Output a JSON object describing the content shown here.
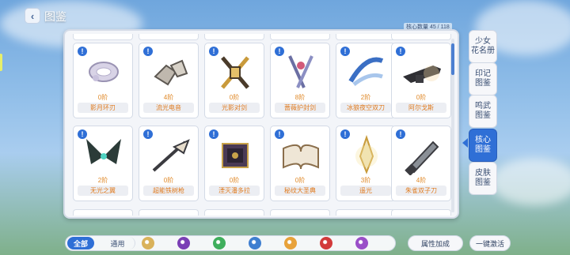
{
  "header": {
    "back_icon": "chevron-left-icon",
    "title": "图鉴",
    "count_label": "核心数量 45 / 118"
  },
  "cards": [
    {
      "tier": "0阶",
      "name": "影月环刃",
      "art": "silver-ring"
    },
    {
      "tier": "4阶",
      "name": "流光电音",
      "art": "stone-pieces"
    },
    {
      "tier": "0阶",
      "name": "光影对剑",
      "art": "crossed-blades"
    },
    {
      "tier": "8阶",
      "name": "蔷薇护封剑",
      "art": "rose-swords"
    },
    {
      "tier": "2阶",
      "name": "冰狼夜空双刀",
      "art": "ice-blades"
    },
    {
      "tier": "0阶",
      "name": "阿尔戈斯",
      "art": "rifle"
    },
    {
      "tier": "2阶",
      "name": "无光之翼",
      "art": "dark-wings"
    },
    {
      "tier": "0阶",
      "name": "超能铁树枪",
      "art": "lance"
    },
    {
      "tier": "0阶",
      "name": "湮灭潘多拉",
      "art": "pandora-box"
    },
    {
      "tier": "0阶",
      "name": "秘纹大圣典",
      "art": "open-book"
    },
    {
      "tier": "3阶",
      "name": "遥光",
      "art": "gold-blade"
    },
    {
      "tier": "4阶",
      "name": "朱雀双子刀",
      "art": "knife"
    }
  ],
  "side_tabs": [
    {
      "label": "少女\n花名册",
      "active": false
    },
    {
      "label": "印记\n图鉴",
      "active": false
    },
    {
      "label": "鸣武\n图鉴",
      "active": false
    },
    {
      "label": "核心\n图鉴",
      "active": true
    },
    {
      "label": "皮肤\n图鉴",
      "active": false
    }
  ],
  "filters": {
    "all": "全部",
    "general": "通用"
  },
  "filter_icons": [
    {
      "name": "element-light-icon",
      "color": "#d9b25a"
    },
    {
      "name": "element-dark-icon",
      "color": "#7a3fb5"
    },
    {
      "name": "element-wind-icon",
      "color": "#3fae5c"
    },
    {
      "name": "element-shield-icon",
      "color": "#3f7fd0"
    },
    {
      "name": "element-sun-icon",
      "color": "#e8a23a"
    },
    {
      "name": "element-fire-icon",
      "color": "#d23a3a"
    },
    {
      "name": "element-void-icon",
      "color": "#9a4fc8"
    }
  ],
  "actions": {
    "attr_bonus": "属性加成",
    "one_click": "一键激活"
  },
  "colors": {
    "accent": "#2f6fd6",
    "tier_text": "#e08a2a"
  }
}
